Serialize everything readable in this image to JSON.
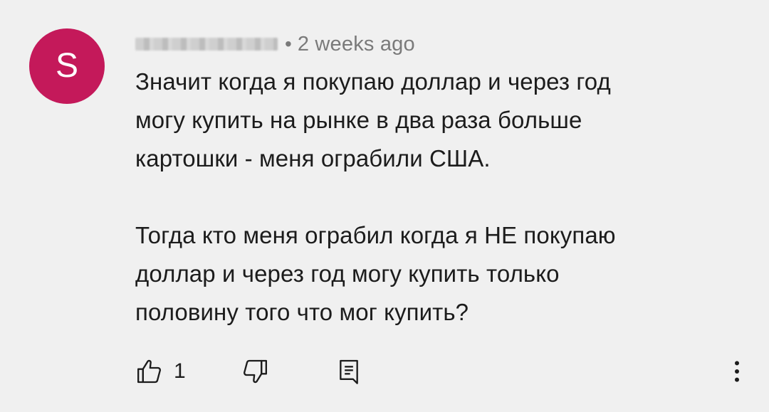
{
  "comment": {
    "avatar": {
      "letter": "S",
      "color": "#c4195a"
    },
    "separator": "•",
    "timestamp": "2 weeks ago",
    "paragraphs": [
      "Значит когда я покупаю доллар и через год\nмогу купить на рынке в два раза больше\nкартошки - меня ограбили США.",
      "Тогда кто меня ограбил когда я НЕ покупаю\nдоллар и через год могу купить только\nполовину того что мог купить?"
    ],
    "actions": {
      "like_icon": "thumbs-up-icon",
      "like_count": "1",
      "dislike_icon": "thumbs-down-icon",
      "reply_icon": "reply-comment-icon",
      "more_icon": "more-vertical-icon"
    }
  }
}
